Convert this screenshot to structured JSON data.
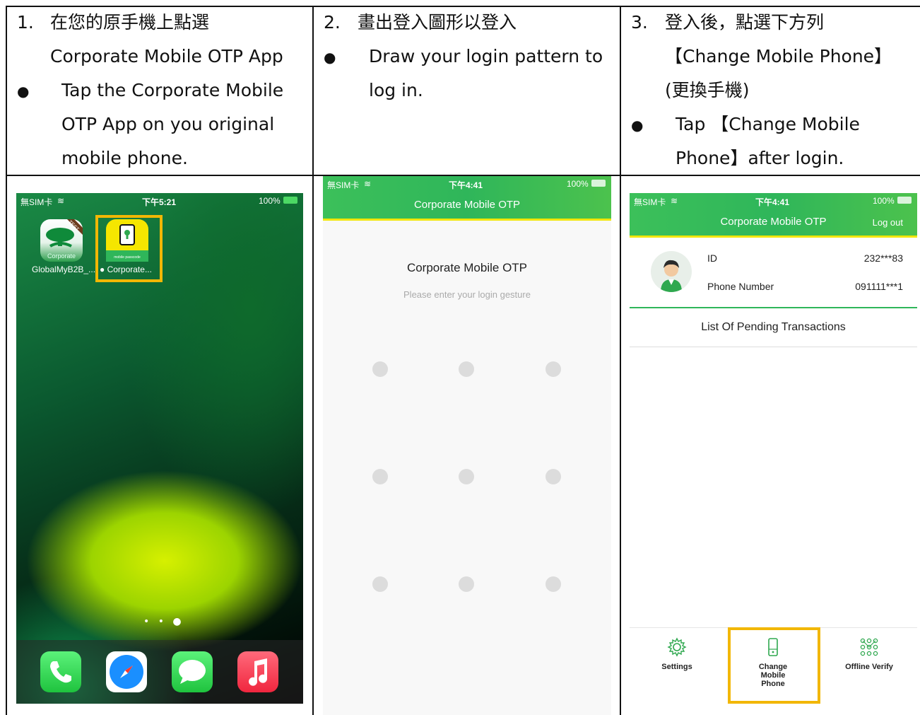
{
  "steps": [
    {
      "number": "1.",
      "zh": "在您的原手機上點選",
      "zh2": "Corporate Mobile OTP App",
      "en_lines": [
        "Tap the Corporate Mobile",
        "OTP App on you original",
        "mobile phone."
      ]
    },
    {
      "number": "2.",
      "zh": "畫出登入圖形以登入",
      "en_lines": [
        "Draw your login pattern to",
        "log in."
      ]
    },
    {
      "number": "3.",
      "zh": "登入後，點選下方列",
      "zh2": "【Change Mobile Phone】",
      "zh3": "(更換手機)",
      "en_lines": [
        "Tap 【Change Mobile",
        "Phone】after login."
      ]
    }
  ],
  "bullet_glyph": "●",
  "phone1": {
    "status": {
      "carrier": "無SIM卡",
      "time": "下午5:21",
      "battery": "100%"
    },
    "apps": [
      {
        "label": "GlobalMyB2B_...",
        "icon_text": "Corporate",
        "badge": "TEST"
      },
      {
        "label": "● Corporate...",
        "icon_text": "mobile passcode"
      }
    ],
    "page_dots": "• • ●"
  },
  "phone2": {
    "status": {
      "carrier": "無SIM卡",
      "time": "下午4:41",
      "battery": "100%"
    },
    "header_title": "Corporate Mobile OTP",
    "title": "Corporate Mobile OTP",
    "subtitle": "Please enter your login gesture"
  },
  "phone3": {
    "status": {
      "carrier": "無SIM卡",
      "time": "下午4:41",
      "battery": "100%"
    },
    "header_title": "Corporate Mobile OTP",
    "logout": "Log out",
    "id_label": "ID",
    "id_value": "232***83",
    "phone_label": "Phone Number",
    "phone_value": "091111***1",
    "pending": "List Of Pending Transactions",
    "tabs": [
      {
        "label": "Settings",
        "icon": "gear-icon"
      },
      {
        "label": "Change Mobile Phone",
        "icon": "phone-icon"
      },
      {
        "label": "Offline Verify",
        "icon": "grid-pattern-icon"
      }
    ]
  },
  "colors": {
    "highlight": "#f2b705",
    "green": "#2fb65a",
    "yellow_bar": "#f2e600"
  }
}
